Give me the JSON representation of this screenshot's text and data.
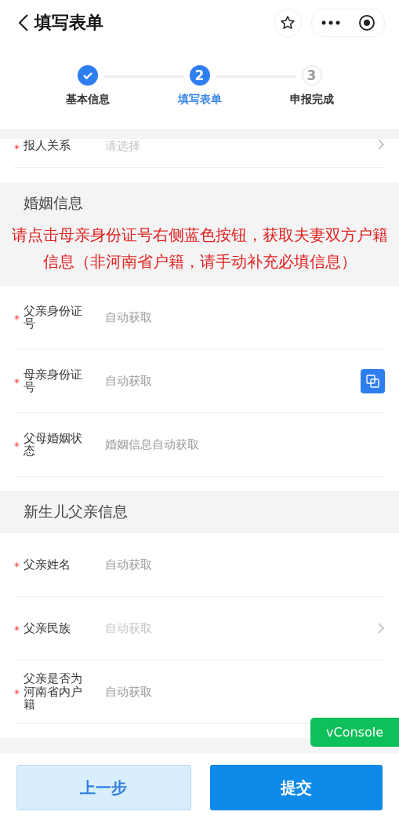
{
  "nav": {
    "title": "填写表单"
  },
  "steps": [
    {
      "label": "基本信息",
      "completed": true,
      "selected": false
    },
    {
      "label": "填写表单",
      "number": "2",
      "completed": false,
      "selected": true
    },
    {
      "label": "申报完成",
      "number": "3",
      "completed": false,
      "selected": false
    }
  ],
  "top_row": {
    "label": "报人关系",
    "placeholder": "请选择",
    "mark": "*",
    "kind": "select"
  },
  "sections": [
    {
      "title": "婚姻信息",
      "notice": "请点击母亲身份证号右侧蓝色按钮，获取夫妻双方户籍信息（非河南省户籍，请手动补充必填信息）",
      "fields": [
        {
          "label": "父亲身份证号",
          "placeholder": "自动获取",
          "mark": "*",
          "kind": "text"
        },
        {
          "label": "母亲身份证号",
          "placeholder": "自动获取",
          "mark": "*",
          "kind": "fetch"
        },
        {
          "label": "父母婚姻状态",
          "placeholder": "婚姻信息自动获取",
          "mark": "*",
          "kind": "text"
        }
      ]
    },
    {
      "title": "新生儿父亲信息",
      "fields": [
        {
          "label": "父亲姓名",
          "placeholder": "自动获取",
          "mark": "*",
          "kind": "text"
        },
        {
          "label": "父亲民族",
          "placeholder": "自动获取",
          "mark": "*",
          "kind": "select"
        },
        {
          "label": "父亲是否为河南省内户籍",
          "placeholder": "自动获取",
          "mark": "*",
          "kind": "text"
        }
      ]
    }
  ],
  "vconsole": "vConsole",
  "buttons": [
    {
      "label": "上一步",
      "kind": "secondary"
    },
    {
      "label": "提交",
      "kind": "primary"
    }
  ]
}
